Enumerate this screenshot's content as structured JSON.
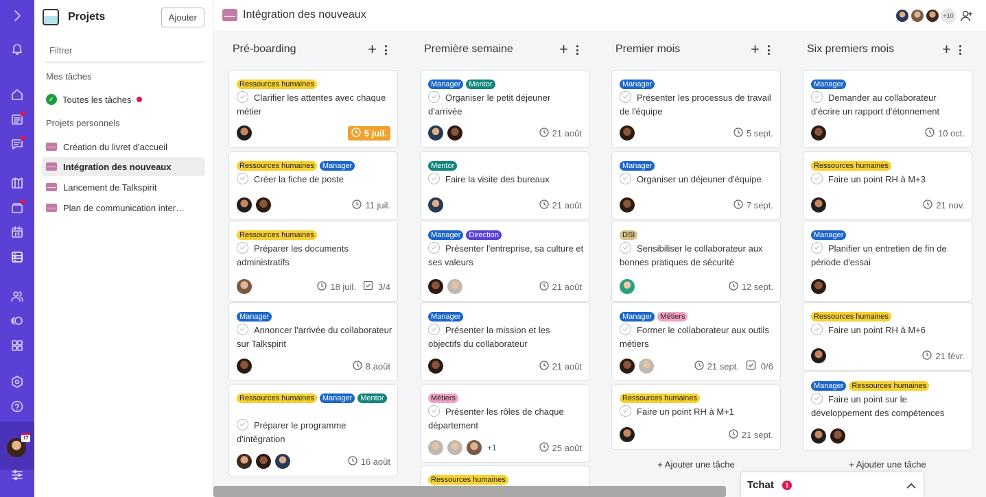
{
  "sidebar": {
    "title": "Projets",
    "add_label": "Ajouter",
    "filter_placeholder": "Filtrer",
    "my_tasks_heading": "Mes tâches",
    "all_tasks_label": "Toutes les tâches",
    "personal_heading": "Projets personnels",
    "projects": [
      "Création du livret d'accueil",
      "Intégration des nouveaux",
      "Lancement de Talkspirit",
      "Plan de communication inter…"
    ]
  },
  "header": {
    "title": "Intégration des nouveaux",
    "more_members": "+10"
  },
  "rail": {
    "calendar_day": "17"
  },
  "columns": [
    {
      "name": "Pré-boarding",
      "cards": [
        {
          "tags": [
            "Ressources humaines"
          ],
          "task": "Clarifier les attentes avec chaque métier",
          "date": "5 juil."
        },
        {
          "tags": [
            "Ressources humaines",
            "Manager"
          ],
          "task": "Créer la fiche de poste",
          "date": "11 juil."
        },
        {
          "tags": [
            "Ressources humaines"
          ],
          "task": "Préparer les documents administratifs",
          "date": "18 juil.",
          "checklist": "3/4"
        },
        {
          "tags": [
            "Manager"
          ],
          "task": "Annoncer l'arrivée du collaborateur sur Talkspirit",
          "date": "8 août"
        },
        {
          "tags": [
            "Ressources humaines",
            "Manager",
            "Mentor"
          ],
          "task": "Préparer le programme d'intégration",
          "date": "16 août"
        }
      ]
    },
    {
      "name": "Première semaine",
      "cards": [
        {
          "tags": [
            "Manager",
            "Mentor"
          ],
          "task": "Organiser le petit déjeuner d'arrivée",
          "date": "21 août"
        },
        {
          "tags": [
            "Mentor"
          ],
          "task": "Faire la visite des bureaux",
          "date": "21 août"
        },
        {
          "tags": [
            "Manager",
            "Direction"
          ],
          "task": "Présenter l'entreprise, sa culture et ses valeurs",
          "date": "21 août"
        },
        {
          "tags": [
            "Manager"
          ],
          "task": "Présenter la mission et les objectifs du collaborateur",
          "date": "21 août"
        },
        {
          "tags": [
            "Métiers"
          ],
          "task": "Présenter les rôles de chaque département",
          "date": "25 août",
          "extra": "+1"
        },
        {
          "tags": [
            "Ressources humaines"
          ]
        }
      ]
    },
    {
      "name": "Premier mois",
      "add_task": "+ Ajouter une tâche",
      "cards": [
        {
          "tags": [
            "Manager"
          ],
          "task": "Présenter les processus de travail de l'équipe",
          "date": "5 sept."
        },
        {
          "tags": [
            "Manager"
          ],
          "task": "Organiser un déjeuner d'équipe",
          "date": "7 sept."
        },
        {
          "tags": [
            "DSI"
          ],
          "task": "Sensibiliser le collaborateur aux bonnes pratiques de sécurité",
          "date": "12 sept."
        },
        {
          "tags": [
            "Manager",
            "Métiers"
          ],
          "task": "Former le collaborateur aux outils métiers",
          "date": "21 sept.",
          "checklist": "0/6"
        },
        {
          "tags": [
            "Ressources humaines"
          ],
          "task": "Faire un point RH à M+1",
          "date": "21 sept."
        }
      ]
    },
    {
      "name": "Six premiers mois",
      "add_task": "+ Ajouter une tâche",
      "cards": [
        {
          "tags": [
            "Manager"
          ],
          "task": "Demander au collaborateur d'écrire un rapport d'étonnement",
          "date": "10 oct."
        },
        {
          "tags": [
            "Ressources humaines"
          ],
          "task": "Faire un point RH à M+3",
          "date": "21 nov."
        },
        {
          "tags": [
            "Manager"
          ],
          "task": "Planifier un entretien de fin de période d'essai",
          "date": ""
        },
        {
          "tags": [
            "Ressources humaines"
          ],
          "task": "Faire un point RH à M+6",
          "date": "21 févr."
        },
        {
          "tags": [
            "Manager",
            "Ressources humaines"
          ],
          "task": "Faire un point sur le développement des compétences",
          "date": ""
        }
      ]
    }
  ],
  "chat": {
    "label": "Tchat",
    "badge": "1"
  }
}
